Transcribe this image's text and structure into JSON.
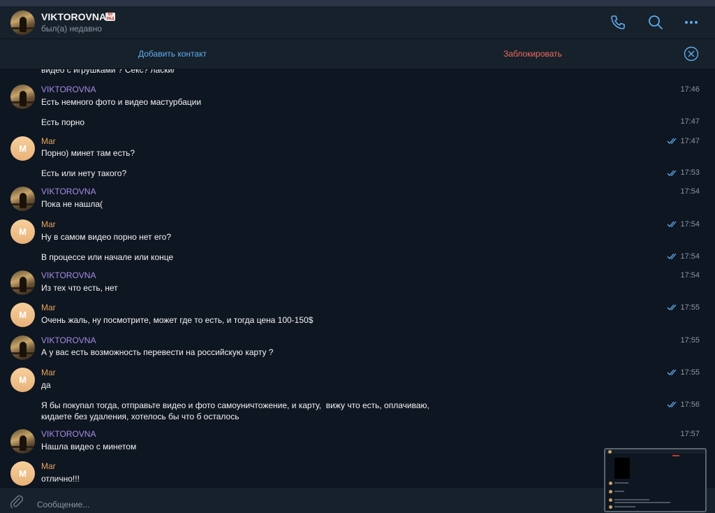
{
  "header": {
    "name": "VIKTOROVNA",
    "badge": "МУ МЕД",
    "status": "был(а) недавно",
    "icons": [
      "phone-icon",
      "search-icon",
      "more-icon"
    ]
  },
  "actionbar": {
    "add_contact": "Добавить контакт",
    "block": "Заблокировать"
  },
  "chat": {
    "cut_line": "видео с игрушками ? Секс? ласки/",
    "messages": [
      {
        "sender": "VIKTOROVNA",
        "text": "Есть немного фото и видео мастурбации",
        "time": "17:46",
        "read": false
      },
      {
        "sender": "",
        "text": "Есть порно",
        "time": "17:47",
        "read": false
      },
      {
        "sender": "Mar",
        "text": "Порно) минет там есть?",
        "time": "17:47",
        "read": true
      },
      {
        "sender": "",
        "text": "Есть или нету такого?",
        "time": "17:53",
        "read": true
      },
      {
        "sender": "VIKTOROVNA",
        "text": "Пока не нашла(",
        "time": "17:54",
        "read": false
      },
      {
        "sender": "Mar",
        "text": "Ну в самом видео порно нет его?",
        "time": "17:54",
        "read": true
      },
      {
        "sender": "",
        "text": "В процессе или начале или конце",
        "time": "17:54",
        "read": true
      },
      {
        "sender": "VIKTOROVNA",
        "text": "Из тех что есть, нет",
        "time": "17:54",
        "read": false
      },
      {
        "sender": "Mar",
        "text": "Очень жаль, ну посмотрите, может где то есть, и тогда цена 100-150$",
        "time": "17:55",
        "read": true
      },
      {
        "sender": "VIKTOROVNA",
        "text": "А у вас есть возможность перевести на российскую карту ?",
        "time": "17:55",
        "read": false
      },
      {
        "sender": "Mar",
        "text": "да",
        "time": "17:55",
        "read": true
      },
      {
        "sender": "",
        "text": "Я бы покупал тогда, отправьте видео и фото самоуничтожение, и карту,  вижу что есть, оплачиваю,\nкидаете без удаления, хотелось бы что б осталось",
        "time": "17:56",
        "read": true
      },
      {
        "sender": "VIKTOROVNA",
        "text": "Нашла видео с минетом",
        "time": "17:57",
        "read": false
      },
      {
        "sender": "Mar",
        "text": "отлично!!!",
        "time": "",
        "read": false
      }
    ],
    "avatar_letter": "M"
  },
  "composer": {
    "placeholder": "Сообщение..."
  },
  "colors": {
    "background": "#0e1621",
    "panel": "#17212b",
    "accent_blue": "#5eadf0",
    "danger_red": "#ef6b60",
    "sender_viktorovna": "#a78ce6",
    "sender_mar": "#e7a55c"
  }
}
